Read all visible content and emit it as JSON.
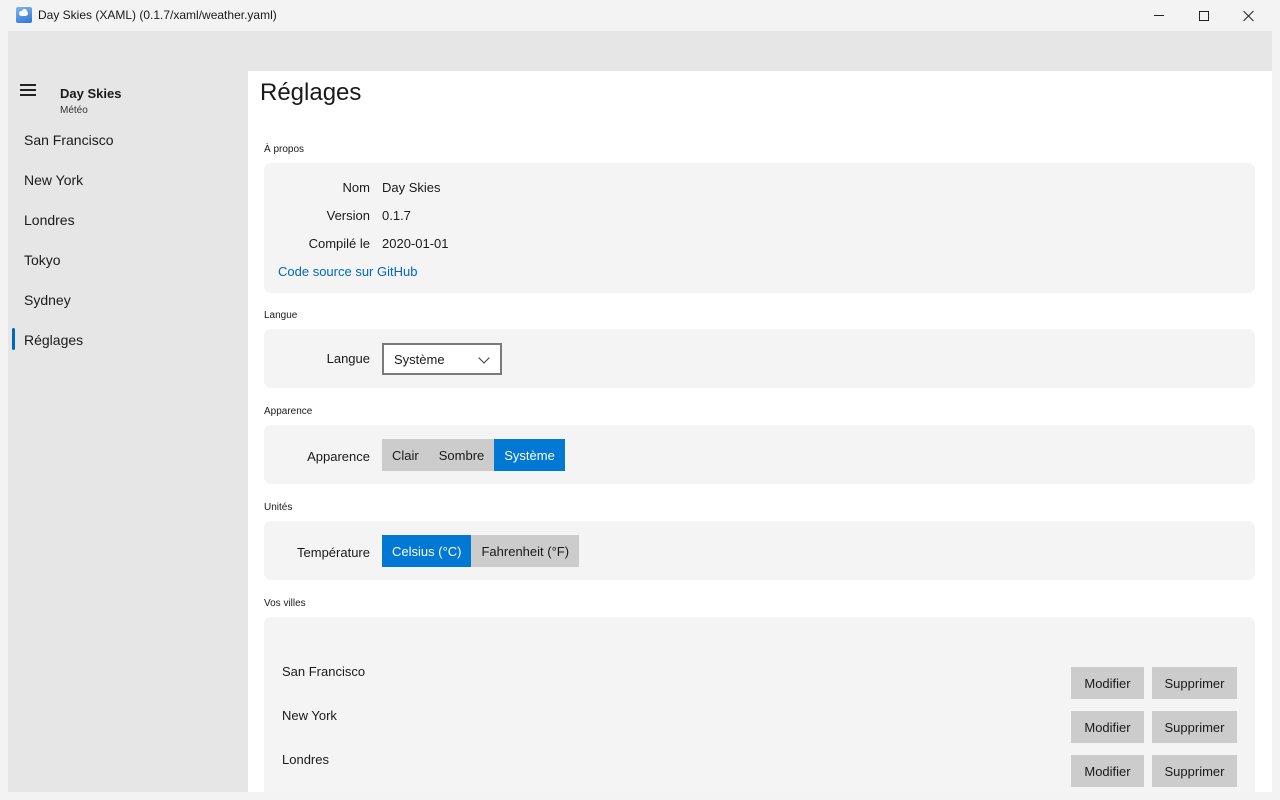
{
  "window": {
    "title": "Day Skies (XAML) (0.1.7/xaml/weather.yaml)"
  },
  "sidebar": {
    "app_name": "Day Skies",
    "app_subtitle": "Météo",
    "items": [
      {
        "label": "San Francisco"
      },
      {
        "label": "New York"
      },
      {
        "label": "Londres"
      },
      {
        "label": "Tokyo"
      },
      {
        "label": "Sydney"
      },
      {
        "label": "Réglages",
        "selected": true
      }
    ]
  },
  "page": {
    "title": "Réglages"
  },
  "about": {
    "section": "À propos",
    "name_label": "Nom",
    "name_value": "Day Skies",
    "version_label": "Version",
    "version_value": "0.1.7",
    "built_label": "Compilé le",
    "built_value": "2020-01-01",
    "source_link": "Code source sur GitHub"
  },
  "language": {
    "section": "Langue",
    "label": "Langue",
    "selected": "Système"
  },
  "appearance": {
    "section": "Apparence",
    "label": "Apparence",
    "options": [
      "Clair",
      "Sombre",
      "Système"
    ],
    "selected": "Système"
  },
  "units": {
    "section": "Unités",
    "label": "Température",
    "options": [
      "Celsius (°C)",
      "Fahrenheit (°F)"
    ],
    "selected": "Celsius (°C)"
  },
  "cities": {
    "section": "Vos villes",
    "edit_label": "Modifier",
    "delete_label": "Supprimer",
    "list": [
      {
        "name": "San Francisco"
      },
      {
        "name": "New York"
      },
      {
        "name": "Londres"
      }
    ]
  },
  "colors": {
    "accent": "#0078d4",
    "link": "#0067c0"
  }
}
